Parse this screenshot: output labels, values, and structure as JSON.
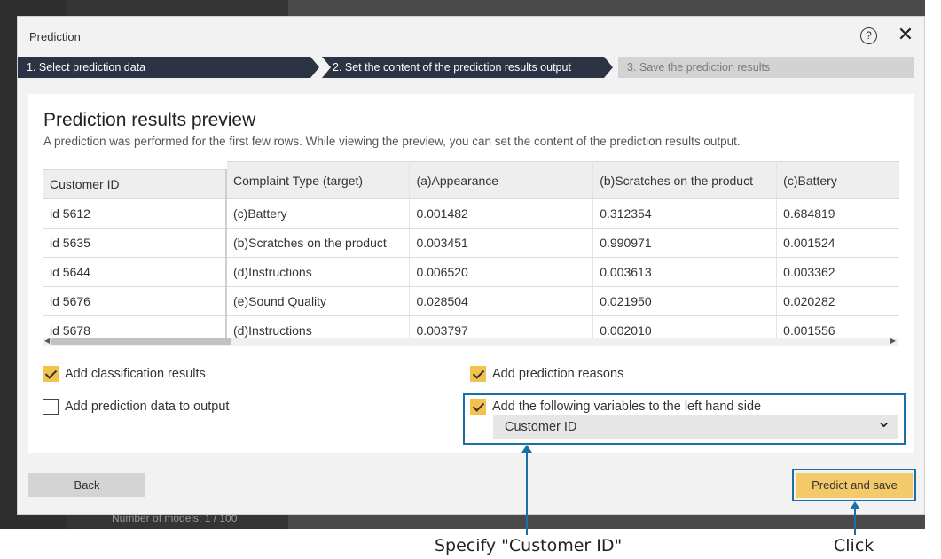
{
  "background": {
    "footer_text": "Number of models: 1 / 100"
  },
  "dialog": {
    "title": "Prediction",
    "help_glyph": "?",
    "close_glyph": "✕",
    "steps": [
      {
        "label": "1. Select prediction data",
        "state": "done"
      },
      {
        "label": "2. Set the content of the prediction results output",
        "state": "active"
      },
      {
        "label": "3. Save the prediction results",
        "state": "pending"
      }
    ]
  },
  "preview": {
    "title": "Prediction results preview",
    "subtitle": "A prediction was performed for the first few rows. While viewing the preview, you can set the content of the prediction results output."
  },
  "table": {
    "fixed_header": "Customer ID",
    "fixed_rows": [
      "id 5612",
      "id 5635",
      "id 5644",
      "id 5676",
      "id 5678"
    ],
    "headers": [
      "Complaint Type (target)",
      "(a)Appearance",
      "(b)Scratches on the product",
      "(c)Battery"
    ],
    "rows": [
      [
        "(c)Battery",
        "0.001482",
        "0.312354",
        "0.684819"
      ],
      [
        "(b)Scratches on the product",
        "0.003451",
        "0.990971",
        "0.001524"
      ],
      [
        "(d)Instructions",
        "0.006520",
        "0.003613",
        "0.003362"
      ],
      [
        "(e)Sound Quality",
        "0.028504",
        "0.021950",
        "0.020282"
      ],
      [
        "(d)Instructions",
        "0.003797",
        "0.002010",
        "0.001556"
      ]
    ]
  },
  "options": {
    "add_classification_results": {
      "label": "Add classification results",
      "checked": true
    },
    "add_prediction_data": {
      "label": "Add prediction data to output",
      "checked": false
    },
    "add_prediction_reasons": {
      "label": "Add prediction reasons",
      "checked": true
    },
    "add_left_vars": {
      "label": "Add the following variables to the left hand side",
      "checked": true
    },
    "left_var_select": "Customer ID"
  },
  "buttons": {
    "back": "Back",
    "predict_save": "Predict and save"
  },
  "annotations": {
    "note_vars": "Specify \"Customer ID\"",
    "note_click": "Click"
  },
  "colors": {
    "accent": "#f3c96a",
    "step_active": "#2b3345",
    "callout": "#1a6fa6"
  }
}
